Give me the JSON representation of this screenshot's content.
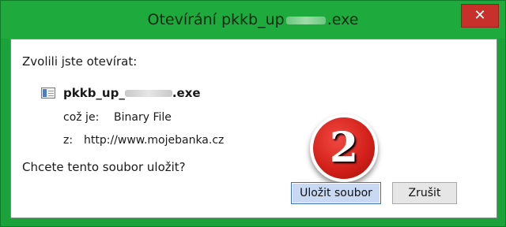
{
  "window": {
    "title_prefix": "Otevírání pkkb_up",
    "title_suffix": ".exe",
    "close_label": "✕"
  },
  "dialog": {
    "intro": "Zvolili jste otevírat:",
    "file_prefix": "pkkb_up_",
    "file_suffix": ".exe",
    "type_label": "což je:",
    "type_value": "Binary File",
    "from_label": "z:",
    "from_value": "http://www.mojebanka.cz",
    "question": "Chcete tento soubor uložit?"
  },
  "badge": {
    "number": "2",
    "color": "#d4211b"
  },
  "buttons": {
    "save_label": "Uložit soubor",
    "cancel_label": "Zrušit"
  },
  "icons": [
    "close-icon",
    "file-icon"
  ],
  "colors": {
    "titlebar": "#1faa3d",
    "badge": "#d4211b",
    "default_button": "#c9d9f3"
  }
}
